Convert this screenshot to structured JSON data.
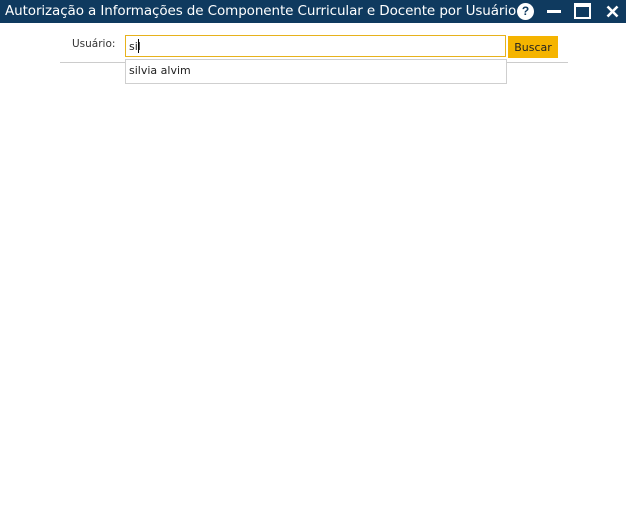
{
  "window": {
    "title": "Autorização a Informações de Componente Curricular e Docente por Usuário",
    "help_symbol": "?",
    "accent_color": "#0f3a5f"
  },
  "form": {
    "user_label": "Usuário:",
    "search_value": "sil",
    "search_button_label": "Buscar",
    "button_color": "#f5b400"
  },
  "autocomplete": {
    "options": [
      "silvia alvim"
    ]
  }
}
